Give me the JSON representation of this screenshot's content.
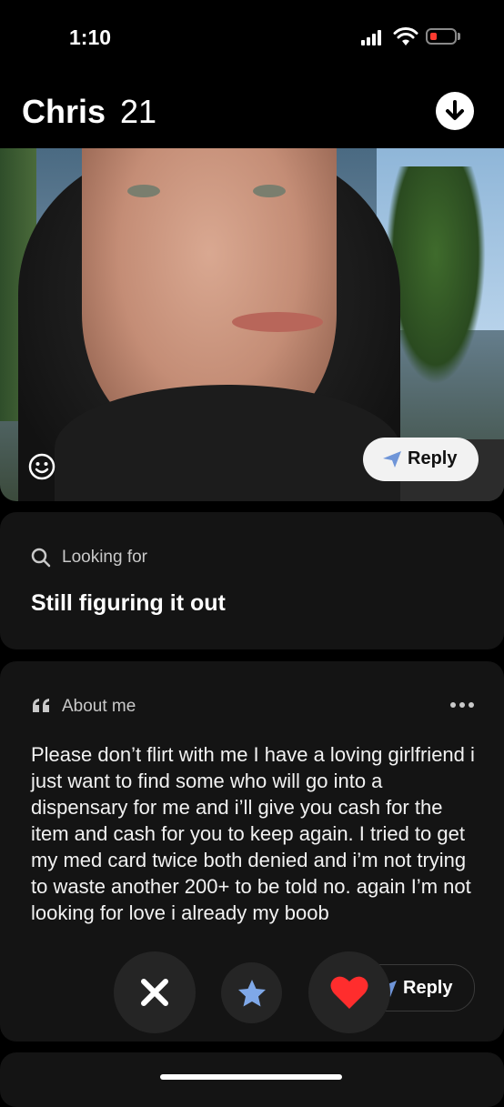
{
  "status_bar": {
    "time": "1:10"
  },
  "header": {
    "name": "Chris",
    "age": "21"
  },
  "photo": {
    "reply_label": "Reply"
  },
  "looking_for": {
    "label": "Looking for",
    "value": "Still figuring it out"
  },
  "about_me": {
    "label": "About me",
    "text": "Please don’t flirt with me I have a loving girlfriend i just want to find some who will go into a dispensary for me and i’ll give you cash for the item and cash for you to keep again. I tried to get my med card twice both denied and i’m not trying to waste another 200+ to be told no. again I’m not looking for love i already my boob",
    "reply_label": "Reply"
  },
  "colors": {
    "like": "#ff2d2d",
    "star": "#7fa8e8",
    "reply_icon": "#6f95d8",
    "battery_low": "#ff3b30"
  },
  "icons": [
    "signal-icon",
    "wifi-icon",
    "battery-icon",
    "download-icon",
    "sticker-icon",
    "send-icon",
    "search-icon",
    "quote-icon",
    "more-icon",
    "close-icon",
    "star-icon",
    "heart-icon"
  ]
}
